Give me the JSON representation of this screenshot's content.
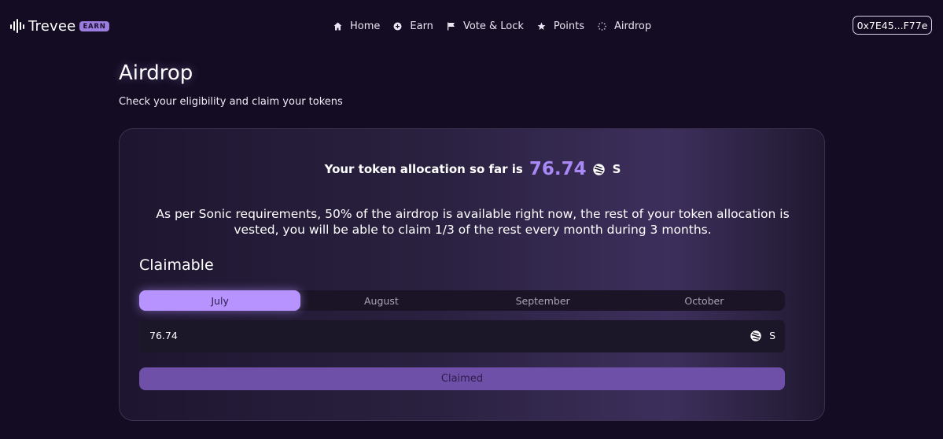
{
  "header": {
    "logo_text": "Trevee",
    "logo_badge": "EARN",
    "nav": [
      {
        "label": "Home",
        "icon": "home-icon"
      },
      {
        "label": "Earn",
        "icon": "earn-icon"
      },
      {
        "label": "Vote & Lock",
        "icon": "flag-icon"
      },
      {
        "label": "Points",
        "icon": "star-icon"
      },
      {
        "label": "Airdrop",
        "icon": "airdrop-icon"
      }
    ],
    "wallet": "0x7E45...F77e"
  },
  "page": {
    "title": "Airdrop",
    "subtitle": "Check your eligibility and claim your tokens"
  },
  "card": {
    "allocation_text": "Your token allocation so far is",
    "allocation_value": "76.74",
    "allocation_unit": "S",
    "token_icon": "sonic-token-icon",
    "description": "As per Sonic requirements, 50% of the airdrop is available right now, the rest of your token allocation is vested, you will be able to claim 1/3 of the rest every month during 3 months.",
    "claimable_title": "Claimable",
    "tabs": [
      "July",
      "August",
      "September",
      "October"
    ],
    "active_tab": "July",
    "amount": "76.74",
    "amount_unit": "S",
    "button_label": "Claimed"
  },
  "colors": {
    "background": "#130c22",
    "accent": "#a889f5",
    "tab_active": "#b793ff",
    "button": "#6f50a8"
  }
}
